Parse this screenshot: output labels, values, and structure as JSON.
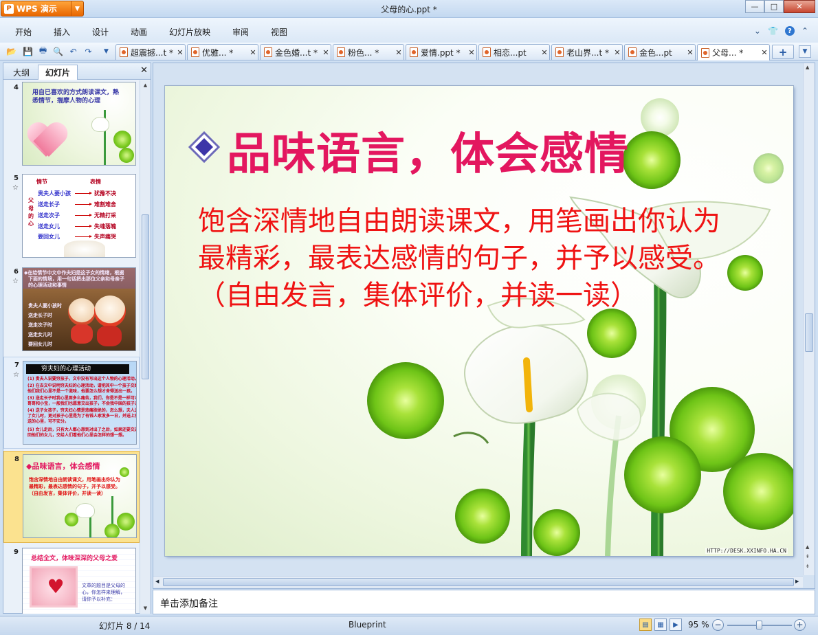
{
  "window": {
    "app_name": "WPS 演示",
    "title": "父母的心.ppt *",
    "min_label": "—",
    "max_label": "□",
    "close_label": "✕"
  },
  "menu": {
    "items": [
      "开始",
      "插入",
      "设计",
      "动画",
      "幻灯片放映",
      "审阅",
      "视图"
    ]
  },
  "tabs": [
    {
      "label": "超震撼...t *",
      "active": false
    },
    {
      "label": "优雅... *",
      "active": false
    },
    {
      "label": "金色婚...t *",
      "active": false
    },
    {
      "label": "粉色... *",
      "active": false
    },
    {
      "label": "爱情.ppt *",
      "active": false
    },
    {
      "label": "相恋...pt",
      "active": false
    },
    {
      "label": "老山界...t *",
      "active": false
    },
    {
      "label": "金色...pt",
      "active": false
    },
    {
      "label": "父母... *",
      "active": true
    }
  ],
  "left_panel": {
    "tab_outline": "大纲",
    "tab_slides": "幻灯片",
    "close_label": "✕"
  },
  "thumbs": {
    "s4": {
      "num": "4",
      "title": "用自已喜欢的方式朗读课文，熟",
      "title2": "悉情节，揣摩人物的心理"
    },
    "s5": {
      "num": "5",
      "col1": "情节",
      "col2": "表情",
      "side": [
        "父",
        "母",
        "的",
        "心"
      ],
      "left": [
        "贵夫人要小孩",
        "送走长子",
        "送走次子",
        "送走女儿",
        "要回女儿"
      ],
      "right": [
        "犹豫不决",
        "难割难舍",
        "无精打采",
        "失魂落魄",
        "失声痛哭"
      ]
    },
    "s6": {
      "num": "6",
      "intro": "◆在给情节中文中作夫妇是这子女的情绪，根据",
      "intro2": "下面的情境，用一句话把出那位父亲和母亲子",
      "intro3": "的心理活动和事情",
      "items": [
        "贵夫人要小孩时",
        "送走长子时",
        "送走次子时",
        "送走女儿时",
        "要回女儿时"
      ]
    },
    "s7": {
      "num": "7",
      "head": "穷夫妇的心理活动",
      "lines": [
        "(1) 贵夫人说要穷孩子，文中没有写出这个人物的心理活动。",
        "(2) 在去文中说明穷夫妇的心理活动，请把其中一个孩子交给",
        "他们我们心里不是一个滋味，他要怎么想才舍得送出一孩。",
        "(3) 送走长子时我心里面多么痛苦，我们，你是不是一样可以心里二",
        "哥哥和小宝，一般我们也愿意交出孩子，不会我中国的孩子去。",
        "(4) 送子女孩子，穷夫妇心情是悲痛欲绝的，怎么想，夫人送走",
        "了女儿时，更对孩子心里是为了有钱人家发多一日，并送上别人",
        "送的心里，可不安分。",
        "(5) 女儿走后，只有大人都心想到对出了之后，如果还要交还",
        "回他们的女儿，交给人们看他们心里会怎样的想一想。"
      ]
    },
    "s8": {
      "num": "8",
      "title": "◆品味语言，体会感情",
      "body1": "饱含深情地自由朗读课文，用笔画出你认为",
      "body2": "最精彩，最表达感情的句子，并予以感受。",
      "body3": "（自由发言，集体评价，并读一读）"
    },
    "s9": {
      "num": "9",
      "title": "总结全文，体味深深的父母之爱",
      "body1": "文章的题目是父母的",
      "body2": "心，你怎样来理解，",
      "body3": "请你予以补充："
    }
  },
  "slide": {
    "title": "品味语言，体会感情",
    "body": [
      "饱含深情地自由朗读课文，用笔画出你认为",
      "最精彩，最表达感情的句子，并予以感受。",
      "（自由发言，集体评价，并读一读）"
    ],
    "credit": "HTTP://DESK.XXINFO.HA.CN",
    "title_color": "#e3175f",
    "body_color": "#ef1313"
  },
  "notes": {
    "placeholder": "单击添加备注"
  },
  "status": {
    "slide_count": "幻灯片 8 / 14",
    "template": "Blueprint",
    "zoom": "95 %",
    "zoom_value": 0.5
  }
}
